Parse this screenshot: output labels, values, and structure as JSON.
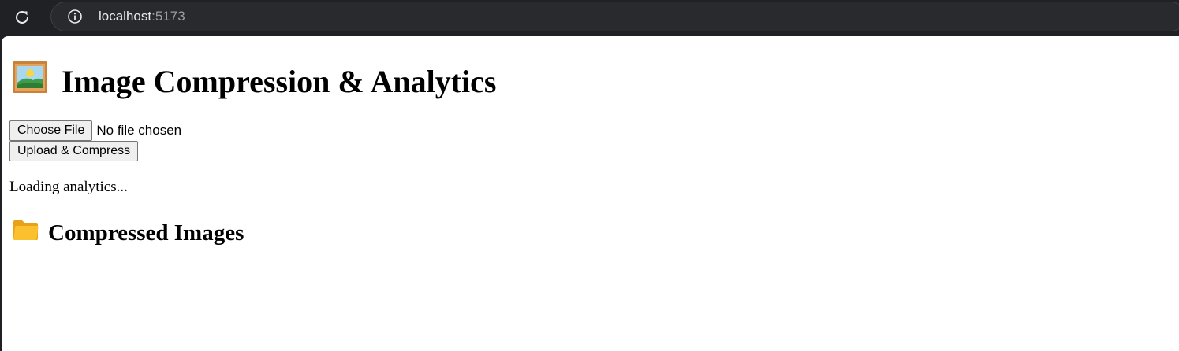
{
  "browser": {
    "url_host": "localhost",
    "url_port": ":5173"
  },
  "page": {
    "title": "Image Compression & Analytics",
    "title_icon": "framed-picture-icon",
    "file_input": {
      "button_label": "Choose File",
      "status": "No file chosen"
    },
    "upload_button_label": "Upload & Compress",
    "loading_text": "Loading analytics...",
    "section_title": "Compressed Images",
    "section_icon": "folder-icon"
  }
}
